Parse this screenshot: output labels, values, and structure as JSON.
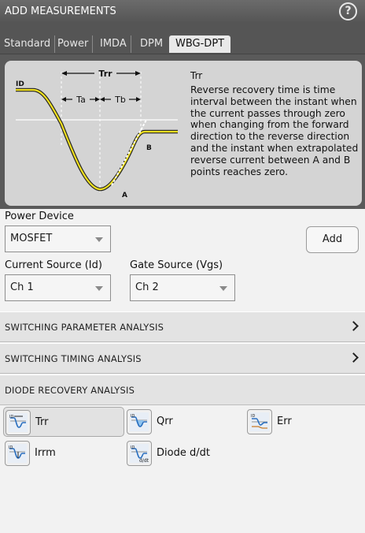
{
  "window": {
    "title": "ADD MEASUREMENTS",
    "help_glyph": "?"
  },
  "tabs": [
    {
      "label": "Standard"
    },
    {
      "label": "Power"
    },
    {
      "label": "IMDA"
    },
    {
      "label": "DPM"
    },
    {
      "label": "WBG-DPT",
      "active": true
    }
  ],
  "diagram": {
    "labels": {
      "id": "ID",
      "trr": "Trr",
      "ta": "Ta",
      "tb": "Tb",
      "a": "A",
      "b": "B"
    },
    "colors": {
      "curve": "#f0e020",
      "background": "#d4d4d4"
    }
  },
  "description": {
    "title": "Trr",
    "text": "Reverse recovery time is time interval between the instant when the current passes through zero when changing from the forward direction to the reverse direction and the instant when extrapolated reverse current between A and B points reaches zero."
  },
  "power_device": {
    "label": "Power Device",
    "value": "MOSFET"
  },
  "current_source": {
    "label": "Current Source (Id)",
    "value": "Ch 1"
  },
  "gate_source": {
    "label": "Gate Source (Vgs)",
    "value": "Ch 2"
  },
  "add_button": {
    "label": "Add"
  },
  "sections": [
    {
      "label": "SWITCHING PARAMETER ANALYSIS",
      "expandable": true
    },
    {
      "label": "SWITCHING TIMING ANALYSIS",
      "expandable": true
    },
    {
      "label": "DIODE RECOVERY ANALYSIS",
      "expanded": true
    }
  ],
  "measurements": [
    {
      "label": "Trr",
      "icon": "trr-icon",
      "selected": true
    },
    {
      "label": "Qrr",
      "icon": "qrr-icon"
    },
    {
      "label": "Err",
      "icon": "err-icon"
    },
    {
      "label": "Irrm",
      "icon": "irrm-icon"
    },
    {
      "label": "Diode d/dt",
      "icon": "diode-ddt-icon"
    }
  ]
}
